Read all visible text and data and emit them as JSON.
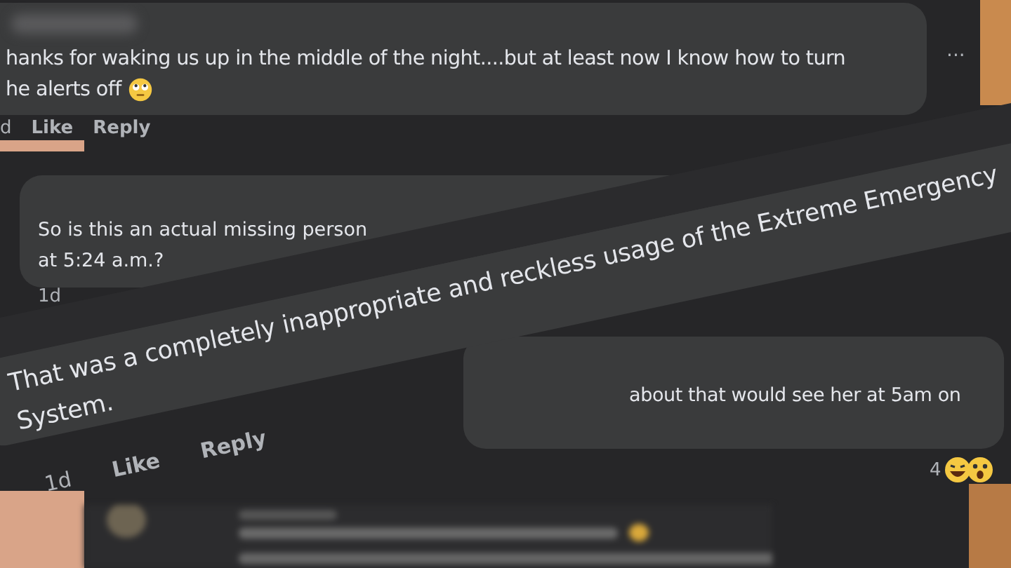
{
  "comment_top": {
    "lines": [
      "hanks for waking us up in the middle of the night....but at least now I know how to turn",
      "he alerts off"
    ],
    "time": "d",
    "actions": [
      "Like",
      "Reply"
    ],
    "menu": "···"
  },
  "comment_middle": {
    "lines": [
      "So is this an actual missing person",
      "at 5:24 a.m.?"
    ],
    "time": "1d"
  },
  "comment_lower": {
    "lines": [
      "about that would see her at 5am on"
    ],
    "reaction_count": "4"
  },
  "comment_tilted": {
    "lines": [
      "That was a completely inappropriate and reckless usage of the Extreme Emergency",
      "System."
    ],
    "time": "1d",
    "actions": [
      "Like",
      "Reply"
    ]
  }
}
